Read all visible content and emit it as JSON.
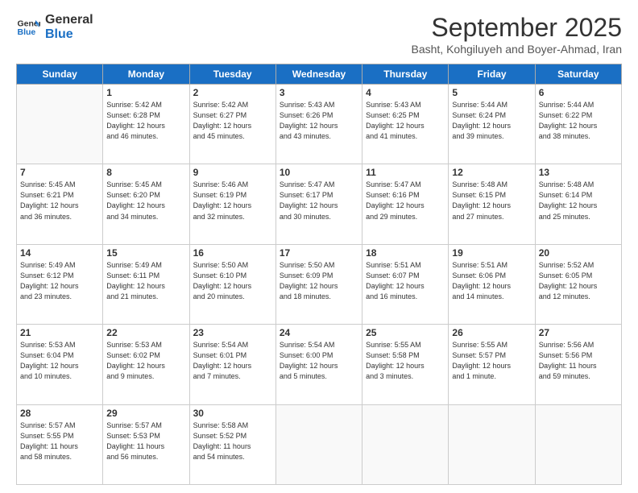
{
  "header": {
    "logo_line1": "General",
    "logo_line2": "Blue",
    "month_title": "September 2025",
    "subtitle": "Basht, Kohgiluyeh and Boyer-Ahmad, Iran"
  },
  "days_of_week": [
    "Sunday",
    "Monday",
    "Tuesday",
    "Wednesday",
    "Thursday",
    "Friday",
    "Saturday"
  ],
  "weeks": [
    [
      {
        "day": "",
        "info": ""
      },
      {
        "day": "1",
        "info": "Sunrise: 5:42 AM\nSunset: 6:28 PM\nDaylight: 12 hours\nand 46 minutes."
      },
      {
        "day": "2",
        "info": "Sunrise: 5:42 AM\nSunset: 6:27 PM\nDaylight: 12 hours\nand 45 minutes."
      },
      {
        "day": "3",
        "info": "Sunrise: 5:43 AM\nSunset: 6:26 PM\nDaylight: 12 hours\nand 43 minutes."
      },
      {
        "day": "4",
        "info": "Sunrise: 5:43 AM\nSunset: 6:25 PM\nDaylight: 12 hours\nand 41 minutes."
      },
      {
        "day": "5",
        "info": "Sunrise: 5:44 AM\nSunset: 6:24 PM\nDaylight: 12 hours\nand 39 minutes."
      },
      {
        "day": "6",
        "info": "Sunrise: 5:44 AM\nSunset: 6:22 PM\nDaylight: 12 hours\nand 38 minutes."
      }
    ],
    [
      {
        "day": "7",
        "info": "Sunrise: 5:45 AM\nSunset: 6:21 PM\nDaylight: 12 hours\nand 36 minutes."
      },
      {
        "day": "8",
        "info": "Sunrise: 5:45 AM\nSunset: 6:20 PM\nDaylight: 12 hours\nand 34 minutes."
      },
      {
        "day": "9",
        "info": "Sunrise: 5:46 AM\nSunset: 6:19 PM\nDaylight: 12 hours\nand 32 minutes."
      },
      {
        "day": "10",
        "info": "Sunrise: 5:47 AM\nSunset: 6:17 PM\nDaylight: 12 hours\nand 30 minutes."
      },
      {
        "day": "11",
        "info": "Sunrise: 5:47 AM\nSunset: 6:16 PM\nDaylight: 12 hours\nand 29 minutes."
      },
      {
        "day": "12",
        "info": "Sunrise: 5:48 AM\nSunset: 6:15 PM\nDaylight: 12 hours\nand 27 minutes."
      },
      {
        "day": "13",
        "info": "Sunrise: 5:48 AM\nSunset: 6:14 PM\nDaylight: 12 hours\nand 25 minutes."
      }
    ],
    [
      {
        "day": "14",
        "info": "Sunrise: 5:49 AM\nSunset: 6:12 PM\nDaylight: 12 hours\nand 23 minutes."
      },
      {
        "day": "15",
        "info": "Sunrise: 5:49 AM\nSunset: 6:11 PM\nDaylight: 12 hours\nand 21 minutes."
      },
      {
        "day": "16",
        "info": "Sunrise: 5:50 AM\nSunset: 6:10 PM\nDaylight: 12 hours\nand 20 minutes."
      },
      {
        "day": "17",
        "info": "Sunrise: 5:50 AM\nSunset: 6:09 PM\nDaylight: 12 hours\nand 18 minutes."
      },
      {
        "day": "18",
        "info": "Sunrise: 5:51 AM\nSunset: 6:07 PM\nDaylight: 12 hours\nand 16 minutes."
      },
      {
        "day": "19",
        "info": "Sunrise: 5:51 AM\nSunset: 6:06 PM\nDaylight: 12 hours\nand 14 minutes."
      },
      {
        "day": "20",
        "info": "Sunrise: 5:52 AM\nSunset: 6:05 PM\nDaylight: 12 hours\nand 12 minutes."
      }
    ],
    [
      {
        "day": "21",
        "info": "Sunrise: 5:53 AM\nSunset: 6:04 PM\nDaylight: 12 hours\nand 10 minutes."
      },
      {
        "day": "22",
        "info": "Sunrise: 5:53 AM\nSunset: 6:02 PM\nDaylight: 12 hours\nand 9 minutes."
      },
      {
        "day": "23",
        "info": "Sunrise: 5:54 AM\nSunset: 6:01 PM\nDaylight: 12 hours\nand 7 minutes."
      },
      {
        "day": "24",
        "info": "Sunrise: 5:54 AM\nSunset: 6:00 PM\nDaylight: 12 hours\nand 5 minutes."
      },
      {
        "day": "25",
        "info": "Sunrise: 5:55 AM\nSunset: 5:58 PM\nDaylight: 12 hours\nand 3 minutes."
      },
      {
        "day": "26",
        "info": "Sunrise: 5:55 AM\nSunset: 5:57 PM\nDaylight: 12 hours\nand 1 minute."
      },
      {
        "day": "27",
        "info": "Sunrise: 5:56 AM\nSunset: 5:56 PM\nDaylight: 11 hours\nand 59 minutes."
      }
    ],
    [
      {
        "day": "28",
        "info": "Sunrise: 5:57 AM\nSunset: 5:55 PM\nDaylight: 11 hours\nand 58 minutes."
      },
      {
        "day": "29",
        "info": "Sunrise: 5:57 AM\nSunset: 5:53 PM\nDaylight: 11 hours\nand 56 minutes."
      },
      {
        "day": "30",
        "info": "Sunrise: 5:58 AM\nSunset: 5:52 PM\nDaylight: 11 hours\nand 54 minutes."
      },
      {
        "day": "",
        "info": ""
      },
      {
        "day": "",
        "info": ""
      },
      {
        "day": "",
        "info": ""
      },
      {
        "day": "",
        "info": ""
      }
    ]
  ]
}
